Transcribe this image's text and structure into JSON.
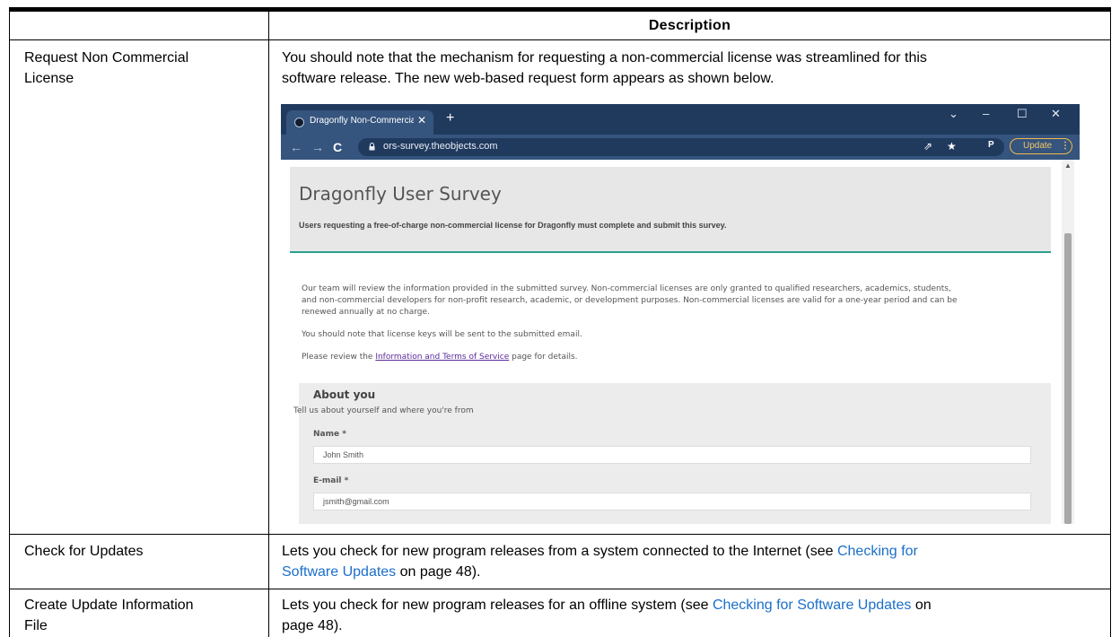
{
  "table": {
    "header": "Description",
    "rows": [
      {
        "name_line1": "Request Non Commercial",
        "name_line2": "License",
        "desc_line1": "You should note that the mechanism for requesting a non-commercial license was streamlined for this",
        "desc_line2": "software release. The new web-based request form appears as shown below."
      },
      {
        "name_line1": "Check for Updates",
        "desc_line1_pre": "Lets you check for new program releases from a system connected to the Internet (see ",
        "desc_line1_link": "Checking for",
        "desc_line2_link": "Software Updates",
        "desc_line2_post": " on page 48)."
      },
      {
        "name_line1": "Create Update Information",
        "name_line2": "File",
        "desc_line1_pre": "Lets you check for new program releases for an offline system (see ",
        "desc_line1_link": "Checking for Software Updates",
        "desc_line1_post": " on",
        "desc_line2": "page 48)."
      }
    ]
  },
  "browser": {
    "tab_title": "Dragonfly Non-Commercial Licen",
    "tab_close": "✕",
    "new_tab": "+",
    "win_dropdown": "⌄",
    "win_min": "–",
    "win_max": "☐",
    "win_close": "✕",
    "nav_back": "←",
    "nav_forward": "→",
    "nav_reload": "C",
    "url": "ors-survey.theobjects.com",
    "share_icon": "⇗",
    "star_icon": "★",
    "profile": "P",
    "update_label": "Update",
    "menu_dots": "⋮"
  },
  "survey": {
    "title": "Dragonfly User Survey",
    "subtitle": "Users requesting a free-of-charge non-commercial license for Dragonfly must complete and submit this survey.",
    "para1_l1": "Our team will review the information provided in the submitted survey. Non-commercial licenses are only granted to qualified researchers, academics, students,",
    "para1_l2": "and non-commercial developers for non-profit research, academic, or development purposes. Non-commercial licenses are valid for a one-year period and can be",
    "para1_l3": "renewed annually at no charge.",
    "para2": "You should note that license keys will be sent to the submitted email.",
    "para3_pre": "Please review the ",
    "para3_link": "Information and Terms of Service",
    "para3_post": " page for details.",
    "about_title": "About you",
    "about_sub": "Tell us about yourself and where you're from",
    "name_label": "Name *",
    "name_value": "John Smith",
    "email_label": "E-mail *",
    "email_value": "jsmith@gmail.com"
  }
}
